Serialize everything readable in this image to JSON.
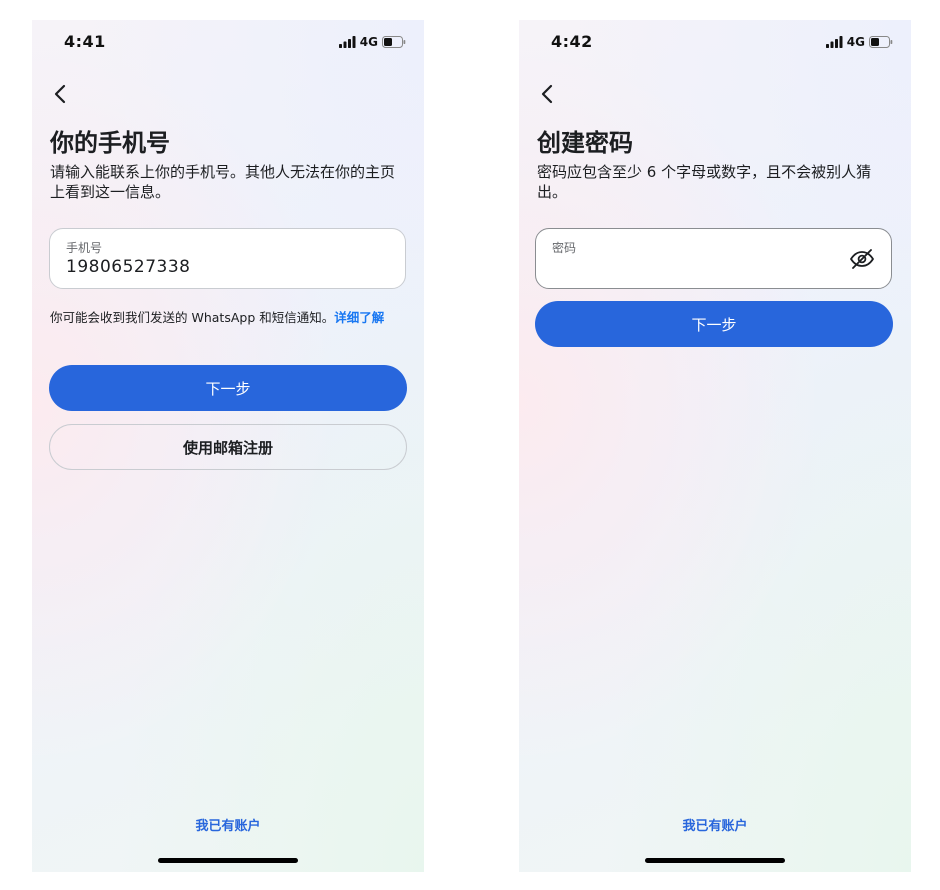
{
  "left_screen": {
    "status": {
      "time": "4:41",
      "network": "4G"
    },
    "title": "你的手机号",
    "subtitle": "请输入能联系上你的手机号。其他人无法在你的主页上看到这一信息。",
    "phone_field": {
      "label": "手机号",
      "value": "19806527338"
    },
    "notice_text": "你可能会收到我们发送的 WhatsApp 和短信通知。",
    "notice_link": "详细了解",
    "next_button": "下一步",
    "email_signup_button": "使用邮箱注册",
    "have_account_link": "我已有账户"
  },
  "right_screen": {
    "status": {
      "time": "4:42",
      "network": "4G"
    },
    "title": "创建密码",
    "subtitle": "密码应包含至少 6 个字母或数字，且不会被别人猜出。",
    "password_field": {
      "label": "密码",
      "value": ""
    },
    "next_button": "下一步",
    "have_account_link": "我已有账户"
  },
  "colors": {
    "primary": "#2866dc",
    "link": "#1877f2",
    "text": "#1c1e21",
    "border": "#c9ccd1"
  },
  "icons": {
    "back": "chevron-left-icon",
    "password_toggle": "eye-off-icon",
    "signal": "signal-bars-icon",
    "battery": "battery-icon"
  }
}
